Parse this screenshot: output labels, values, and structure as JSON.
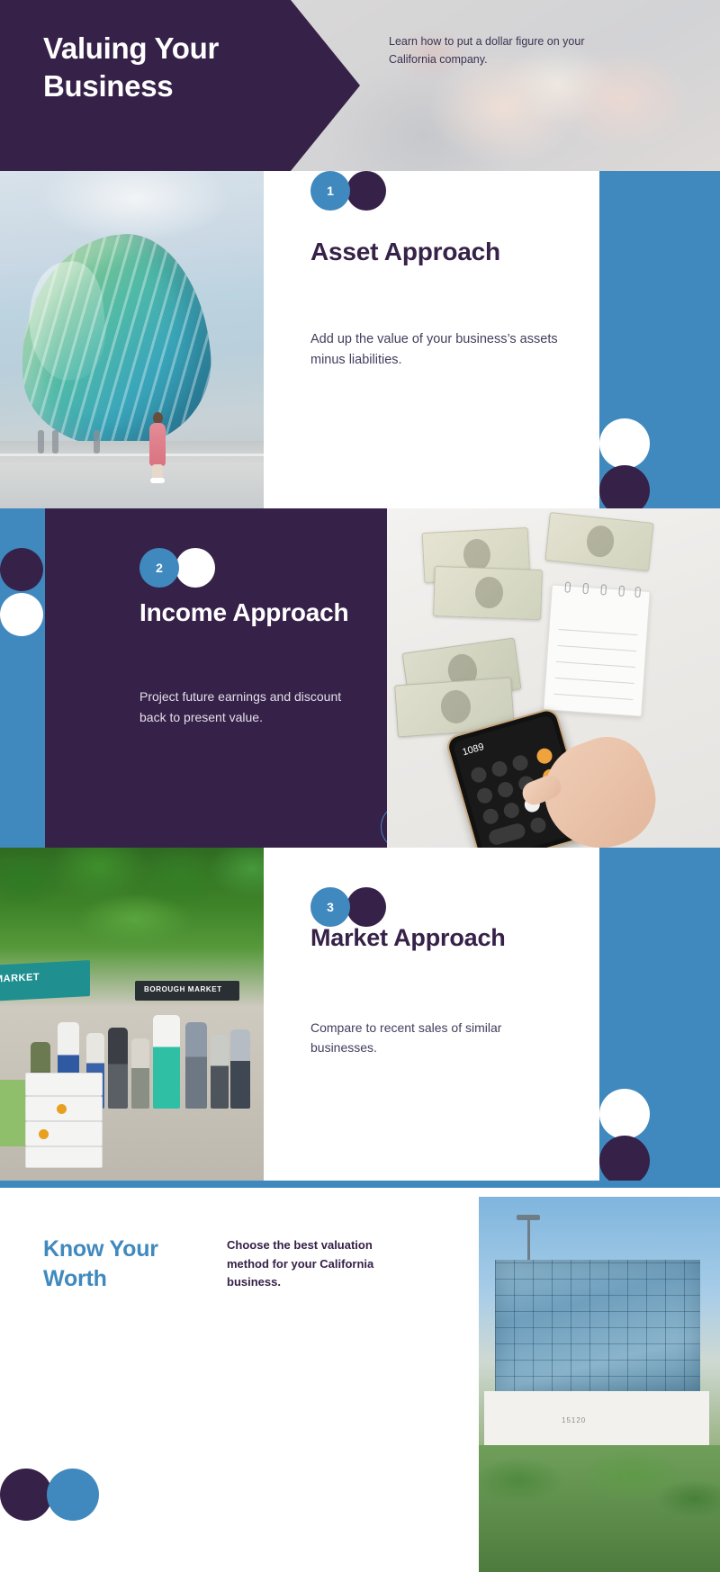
{
  "header": {
    "title": "Valuing Your Business",
    "subtitle": "Learn how to put a dollar figure on your California company."
  },
  "sections": [
    {
      "number": "1",
      "title": "Asset Approach",
      "body": "Add up the value of your business’s assets minus liabilities.",
      "image_alt": "modern-glass-building-photo"
    },
    {
      "number": "2",
      "title": "Income Approach",
      "body": "Project future earnings and discount back to present value.",
      "image_alt": "cash-calculator-notepad-photo",
      "calculator_display": "1089"
    },
    {
      "number": "3",
      "title": "Market Approach",
      "body": "Compare to recent sales of similar businesses.",
      "image_alt": "outdoor-farmers-market-photo",
      "awning_label": "MARKET",
      "sign_label": "BOROUGH MARKET"
    }
  ],
  "footer": {
    "heading": "Know Your Worth",
    "body": "Choose the best valuation method for your California business.",
    "image_alt": "office-building-photo",
    "building_sign": "15120"
  },
  "colors": {
    "purple": "#362148",
    "blue": "#4089BF",
    "white": "#FFFFFF",
    "body_text": "#443C5C"
  }
}
